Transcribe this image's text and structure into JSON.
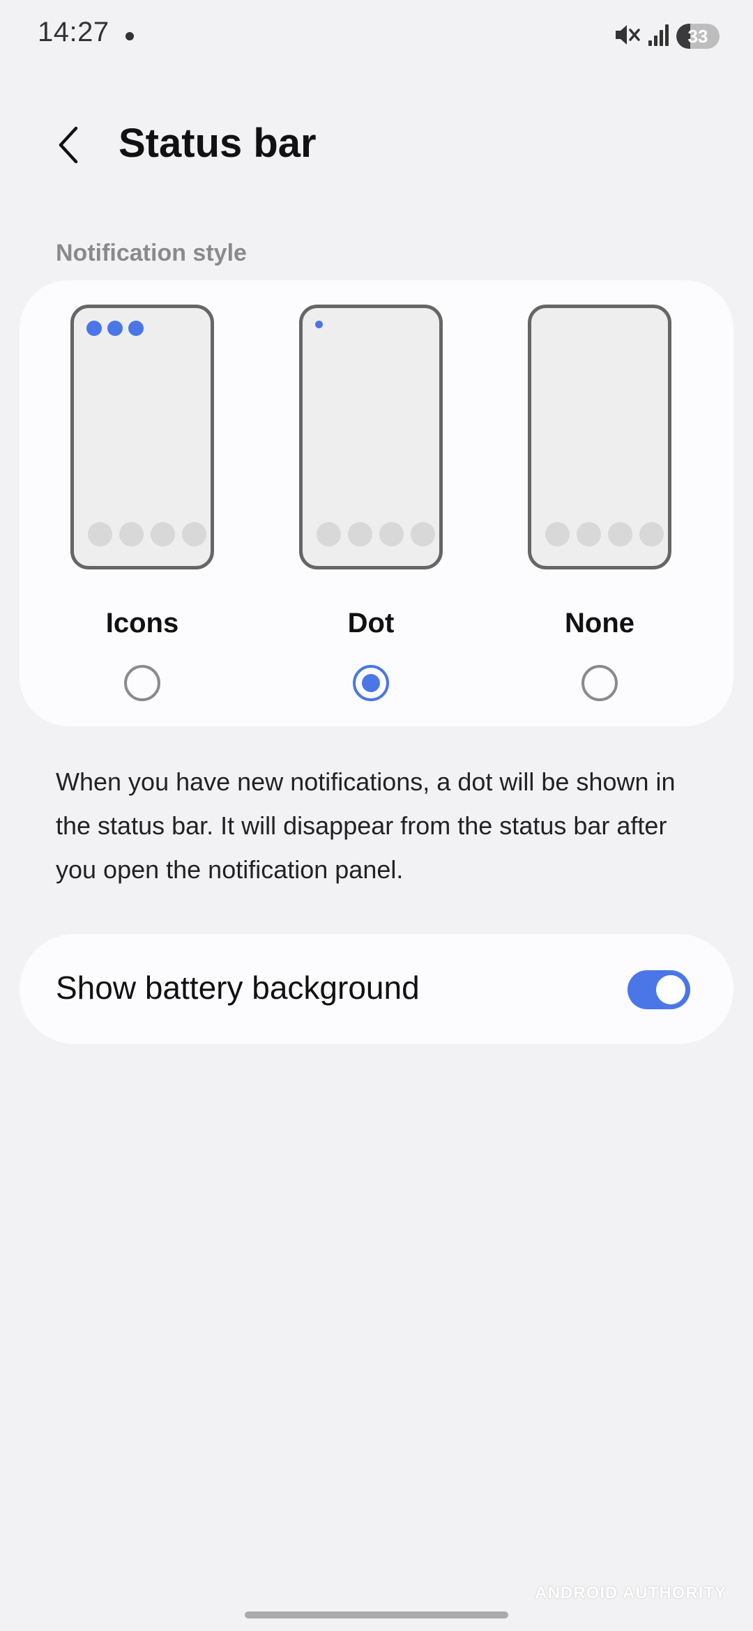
{
  "status_bar": {
    "time": "14:27",
    "battery_level": 33,
    "battery_text": "33",
    "icons": [
      "notification-dot-icon",
      "mute-icon",
      "signal-icon",
      "battery-icon"
    ]
  },
  "header": {
    "title": "Status bar",
    "back_icon": "chevron-left-icon"
  },
  "notification_style": {
    "section_label": "Notification style",
    "options": [
      {
        "label": "Icons",
        "selected": false
      },
      {
        "label": "Dot",
        "selected": true
      },
      {
        "label": "None",
        "selected": false
      }
    ],
    "description": "When you have new notifications, a dot will be shown in the status bar. It will disappear from the status bar after you open the notification panel."
  },
  "battery_background": {
    "label": "Show battery background",
    "enabled": true
  },
  "watermark": "ANDROID AUTHORITY",
  "colors": {
    "accent": "#4a76e8",
    "background": "#f2f2f4",
    "card": "#fcfcfe"
  }
}
